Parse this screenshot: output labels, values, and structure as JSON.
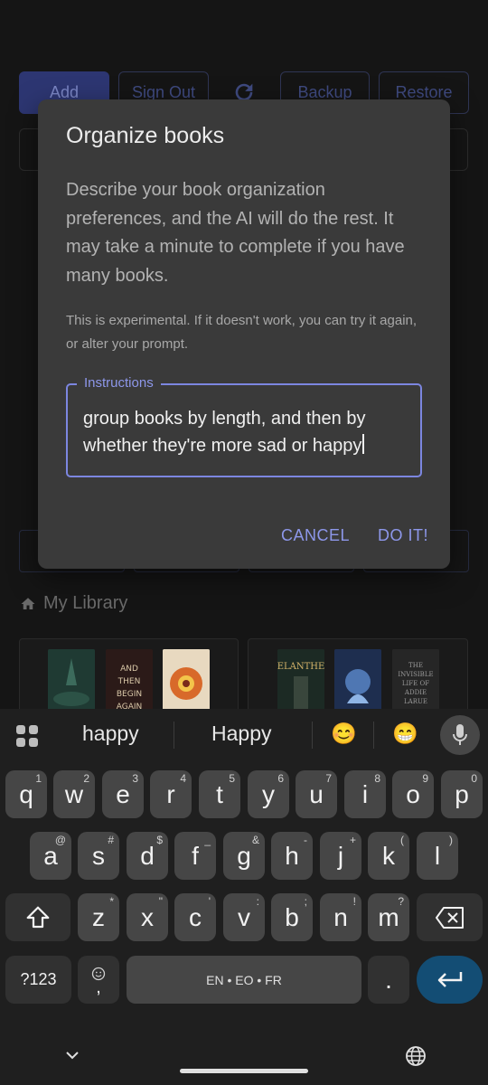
{
  "background": {
    "toolbar": {
      "add": "Add",
      "sign_out": "Sign Out",
      "backup": "Backup",
      "restore": "Restore"
    },
    "library_title": "My Library",
    "book_covers": [
      {
        "title": "",
        "color": "#1f3a33"
      },
      {
        "title": "AND THEN BEGIN AGAIN",
        "color": "#2b1a18"
      },
      {
        "title": "",
        "color": "#e8d9c0"
      },
      {
        "title": "ELANTHE",
        "color": "#1c2a24"
      },
      {
        "title": "",
        "color": "#1e2e4f"
      },
      {
        "title": "THE INVISIBLE LIFE OF ADDIE LARUE V.E.",
        "color": "#262626"
      }
    ]
  },
  "dialog": {
    "title": "Organize books",
    "description": "Describe your book organization preferences, and the AI will do the rest. It may take a minute to complete if you have many books.",
    "note": "This is experimental. If it doesn't work, you can try it again, or alter your prompt.",
    "field_label": "Instructions",
    "field_value": "group books by length, and then by whether they're more sad or happy",
    "cancel": "CANCEL",
    "confirm": "DO IT!"
  },
  "keyboard": {
    "suggestions": [
      "happy",
      "Happy",
      "😊",
      "😁"
    ],
    "row1": [
      [
        "q",
        "1"
      ],
      [
        "w",
        "2"
      ],
      [
        "e",
        "3"
      ],
      [
        "r",
        "4"
      ],
      [
        "t",
        "5"
      ],
      [
        "y",
        "6"
      ],
      [
        "u",
        "7"
      ],
      [
        "i",
        "8"
      ],
      [
        "o",
        "9"
      ],
      [
        "p",
        "0"
      ]
    ],
    "row2": [
      [
        "a",
        "@"
      ],
      [
        "s",
        "#"
      ],
      [
        "d",
        "$"
      ],
      [
        "f",
        "_"
      ],
      [
        "g",
        "&"
      ],
      [
        "h",
        "-"
      ],
      [
        "j",
        "+"
      ],
      [
        "k",
        "("
      ],
      [
        "l",
        ")"
      ]
    ],
    "row3": [
      [
        "z",
        "*"
      ],
      [
        "x",
        "\""
      ],
      [
        "c",
        "'"
      ],
      [
        "v",
        ":"
      ],
      [
        "b",
        ";"
      ],
      [
        "n",
        "!"
      ],
      [
        "m",
        "?"
      ]
    ],
    "symbols_key": "?123",
    "comma_key": ",",
    "space_label": "EN • EO • FR",
    "period_key": "."
  }
}
